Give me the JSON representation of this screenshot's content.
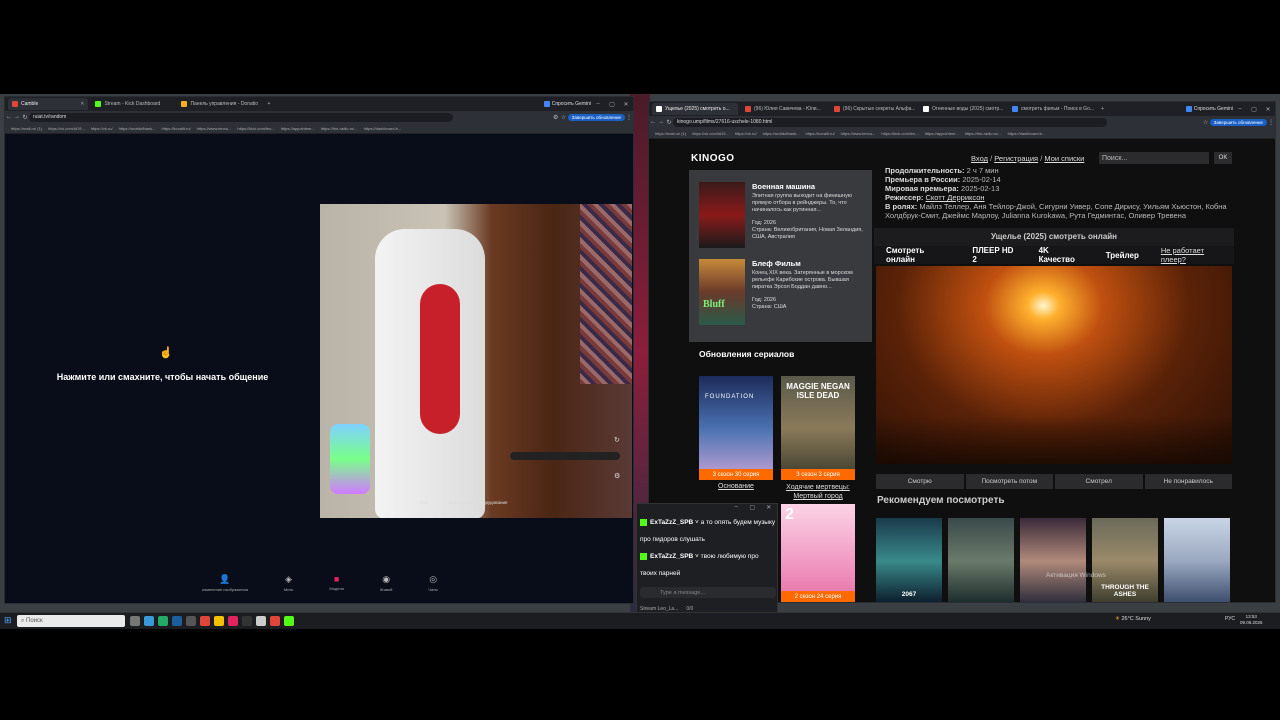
{
  "left_window": {
    "tabs": [
      {
        "label": "Camble",
        "color": "#e0453a",
        "active": true
      },
      {
        "label": "Stream - Kick Dashboard",
        "color": "#53fc18",
        "active": false
      },
      {
        "label": "Панель управления - Donatio",
        "color": "#f2b01e",
        "active": false
      }
    ],
    "url": "ruiat.tv/random",
    "update_button": "Завершить обновление",
    "gemini_label": "Спросить Gemini",
    "bookmarks": [
      "https://mail.ru/ (1)",
      "https://vk.com/id19...",
      "https://vk.ru/",
      "https://worldofbank...",
      "https://kovalit.ru/",
      "https://www.tenxu...",
      "https://kick.com/leo...",
      "https://appointme...",
      "https://the-radio.ru/...",
      "https://dashboard.b..."
    ],
    "prompt_text": "Нажмите или смахните, чтобы начать общение",
    "bottom_bar": [
      {
        "label": "изменение изображения",
        "icon": "person-icon"
      },
      {
        "label": "Мить",
        "icon": "mask-icon"
      },
      {
        "label": "Модели",
        "icon": "gift-icon"
      },
      {
        "label": "Живой",
        "icon": "chat-icon"
      },
      {
        "label": "Чаты",
        "icon": "comments-icon"
      }
    ],
    "camera_overlay": {
      "left": "Фон",
      "right": "Медицинское оборудование"
    }
  },
  "right_window": {
    "tabs": [
      {
        "label": "Ущелье (2025) смотреть о...",
        "color": "#ffffff",
        "active": true
      },
      {
        "label": "(96) Юлия Савичева - Юли...",
        "color": "#e0453a",
        "active": false
      },
      {
        "label": "(96) Скрытые секреты Альфа...",
        "color": "#e0453a",
        "active": false
      },
      {
        "label": "Огненные воды (2025) смотр...",
        "color": "#ffffff",
        "active": false
      },
      {
        "label": "смотреть фильм - Поиск в Go...",
        "color": "#4285f4",
        "active": false
      }
    ],
    "url": "kinogo.ump/films/27616-uschele-1080.html",
    "update_button": "Завершить обновление",
    "gemini_label": "Спросить Gemini",
    "bookmarks": [
      "https://mail.ru/ (1)",
      "https://vk.com/id19...",
      "https://vk.ru/",
      "https://worldofbank...",
      "https://kovalit.ru/",
      "https://www.tenxu...",
      "https://kick.com/leo...",
      "https://appointme...",
      "https://the-radio.ru/...",
      "https://dashboard.b..."
    ]
  },
  "site": {
    "logo": "KINOGO",
    "nav": {
      "login": "Вход",
      "register": "Регистрация",
      "lists": "Мои списки",
      "sep": "/"
    },
    "search_placeholder": "Поиск...",
    "ok_button": "OK",
    "sidebar_movies": [
      {
        "title": "Военная машина",
        "desc": "Элитная группа выходит на финишную прямую отбора в рейнджеры. То, что начиналось как рутинная...",
        "year": "Год: 2026",
        "country": "Страна: Великобритания, Новая Зеландия, США, Австралия"
      },
      {
        "title": "Блеф Фильм",
        "desc": "Конец XIX века. Затерянные в морском рельефе Карибские острова. Бывшая пиратка Эрсол Боддан давно...",
        "year": "Год: 2026",
        "country": "Страна: США"
      }
    ],
    "series_heading": "Обновления сериалов",
    "series": [
      {
        "title": "Основание",
        "badge": "3 сезон 30 серия"
      },
      {
        "title": "Ходячие мертвецы: Мертвый город",
        "badge": "3 сезон 3 серия"
      },
      {
        "title": "",
        "badge": "2 сезон 24 серия"
      }
    ],
    "info": [
      {
        "label": "Продолжительность:",
        "value": "2 ч 7 мин"
      },
      {
        "label": "Премьера в России:",
        "value": "2025-02-14"
      },
      {
        "label": "Мировая премьера:",
        "value": "2025-02-13"
      },
      {
        "label": "Режиссер:",
        "value": "Скотт Дерриксон"
      },
      {
        "label": "В ролях:",
        "value": "Майлз Теллер, Аня Тейлор-Джой, Сигурни Уивер, Сопе Дирису, Уильям Хьюстон, Кобна Холдбрук-Смит, Джеймс Марлоу, Julianna Kurokawa, Рута Гедминтас, Оливер Тревена"
      }
    ],
    "watch_heading": "Ущелье (2025) смотреть онлайн",
    "player_tabs": [
      "Смотреть онлайн",
      "ПЛЕЕР HD 2",
      "4K Качество",
      "Трейлер"
    ],
    "player_broken": "Не работает плеер?",
    "rating_stars": 4,
    "actions": [
      "Смотрю",
      "Посмотреть потом",
      "Смотрел",
      "Не понравилось"
    ],
    "recommend_heading": "Рекомендуем посмотреть",
    "recommend": [
      "2067",
      "",
      "",
      "THROUGH THE ASHES",
      ""
    ],
    "activation_text": "Активация Windows"
  },
  "chat": {
    "messages": [
      {
        "user": "ExTaZzZ_SPB",
        "text": "а то опять будем музыку про пидоров слушать"
      },
      {
        "user": "ExTaZzZ_SPB",
        "text": "твою любимую про твоих парней"
      }
    ],
    "input_placeholder": "Type a message...",
    "footer_name": "Stream Leo_La...",
    "footer_count": "0/0"
  },
  "taskbar": {
    "search": "Поиск",
    "weather": "26°C Sunny",
    "lang": "РУС",
    "time": "13:53",
    "date": "09.06.2025"
  },
  "colors": {
    "site_bg": "#0f0f10",
    "sidebar_bg": "#383a3e",
    "badge_orange": "#ff6a00",
    "kick_green": "#53fc18"
  }
}
